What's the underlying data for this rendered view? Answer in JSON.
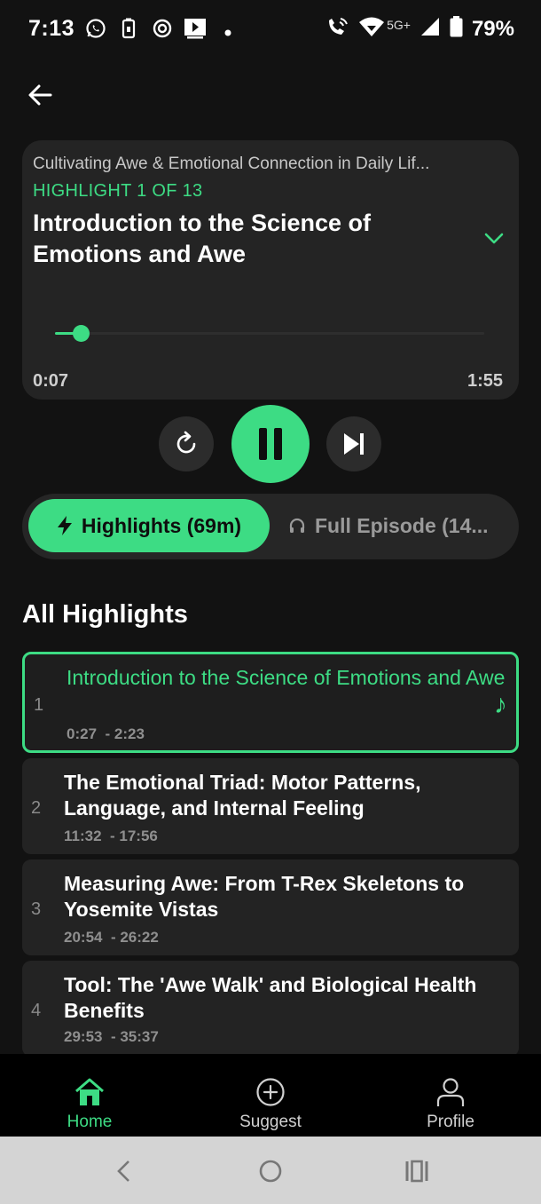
{
  "status_bar": {
    "time": "7:13",
    "network": "5G+",
    "battery": "79%",
    "left_icons": [
      "whatsapp-icon",
      "battery-saver-icon",
      "vpn-icon",
      "media-icon",
      "dot-icon"
    ],
    "right_icons": [
      "wifi-calling-icon",
      "wifi-icon",
      "signal-icon",
      "battery-icon"
    ]
  },
  "player": {
    "episode_title": "Cultivating Awe & Emotional Connection in Daily Lif...",
    "highlight_count": "HIGHLIGHT 1 OF 13",
    "highlight_title": "Introduction to the Science of Emotions and Awe",
    "current_time": "0:07",
    "total_time": "1:55",
    "progress": 0.06
  },
  "controls": {
    "replay_icon": "replay-icon",
    "pause_icon": "pause-icon",
    "next_icon": "skip-next-icon"
  },
  "mode_toggle": {
    "highlights_label": "Highlights (69m)",
    "full_episode_label": "Full Episode (14..."
  },
  "highlights": {
    "section_title": "All Highlights",
    "items": [
      {
        "num": "1",
        "title": "Introduction to the Science of Emotions and Awe",
        "start": "0:27",
        "end": "- 2:23"
      },
      {
        "num": "2",
        "title": "The Emotional Triad: Motor Patterns, Language, and Internal Feeling",
        "start": "11:32",
        "end": "- 17:56"
      },
      {
        "num": "3",
        "title": "Measuring Awe: From T-Rex Skeletons to Yosemite Vistas",
        "start": "20:54",
        "end": "- 26:22"
      },
      {
        "num": "4",
        "title": "Tool: The 'Awe Walk' and Biological Health Benefits",
        "start": "29:53",
        "end": "- 35:37"
      }
    ]
  },
  "bottom_nav": {
    "home": "Home",
    "suggest": "Suggest",
    "profile": "Profile"
  },
  "colors": {
    "accent": "#3ddc84",
    "background": "#121212",
    "card": "#242424"
  }
}
